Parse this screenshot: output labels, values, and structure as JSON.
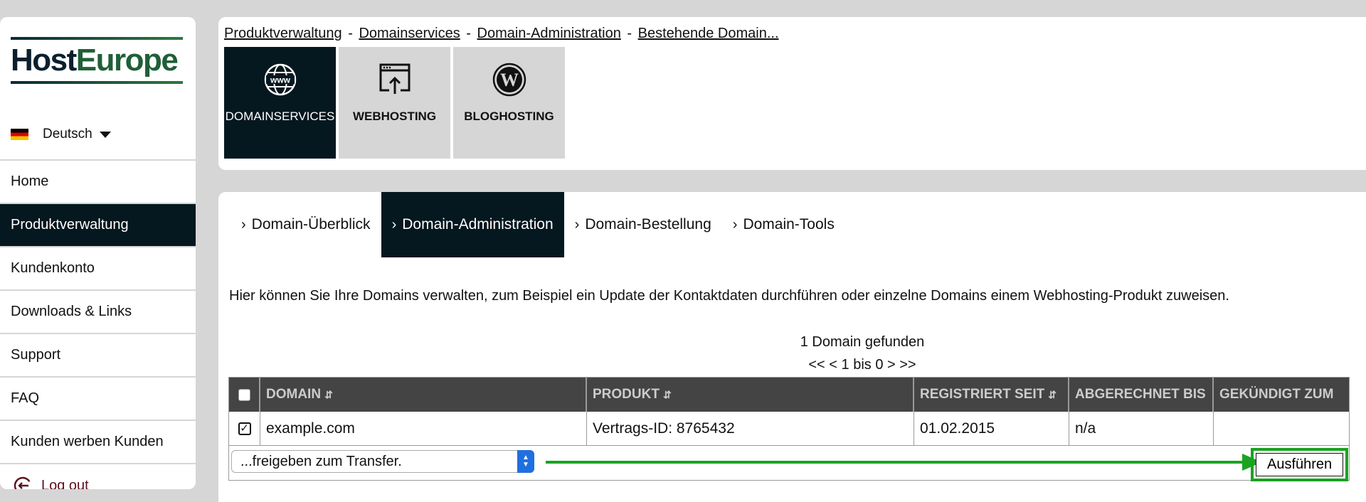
{
  "sidebar": {
    "logo": "Host Europe",
    "logo_part1": "Host",
    "logo_part2": "Europe",
    "language": "Deutsch",
    "items": [
      {
        "label": "Home"
      },
      {
        "label": "Produktverwaltung"
      },
      {
        "label": "Kundenkonto"
      },
      {
        "label": "Downloads & Links"
      },
      {
        "label": "Support"
      },
      {
        "label": "FAQ"
      },
      {
        "label": "Kunden werben Kunden"
      }
    ],
    "logout": "Log out"
  },
  "breadcrumb": [
    {
      "label": "Produktverwaltung"
    },
    {
      "label": "Domainservices"
    },
    {
      "label": "Domain-Administration"
    },
    {
      "label": "Bestehende Domain..."
    }
  ],
  "breadcrumb_sep": "-",
  "service_tiles": [
    {
      "label": "DOMAINSERVICES",
      "icon": "www-globe-icon",
      "active": true
    },
    {
      "label": "WEBHOSTING",
      "icon": "upload-window-icon",
      "active": false
    },
    {
      "label": "BLOGHOSTING",
      "icon": "wordpress-icon",
      "active": false
    }
  ],
  "subtabs": [
    {
      "label": "Domain-Überblick"
    },
    {
      "label": "Domain-Administration",
      "active": true
    },
    {
      "label": "Domain-Bestellung"
    },
    {
      "label": "Domain-Tools"
    }
  ],
  "intro_text": "Hier können Sie Ihre Domains verwalten, zum Beispiel ein Update der Kontaktdaten durchführen oder einzelne Domains einem Webhosting-Produkt zuweisen.",
  "found_text": "1 Domain gefunden",
  "pager_text": "<< <  1 bis 0 > >>",
  "table": {
    "headers": [
      "DOMAIN",
      "PRODUKT",
      "REGISTRIERT SEIT",
      "ABGERECHNET BIS",
      "GEKÜNDIGT ZUM"
    ],
    "rows": [
      {
        "domain": "example.com",
        "produkt": "Vertrags-ID: 8765432",
        "registriert": "01.02.2015",
        "abgerechnet": "n/a",
        "gekuendigt": "",
        "checked": true
      }
    ]
  },
  "action": {
    "selected": "...freigeben zum Transfer.",
    "button": "Ausführen"
  },
  "colors": {
    "dark": "#05171f",
    "highlight_green": "#1aa321",
    "select_blue": "#1f6fe0",
    "logout": "#5c0f1c"
  }
}
